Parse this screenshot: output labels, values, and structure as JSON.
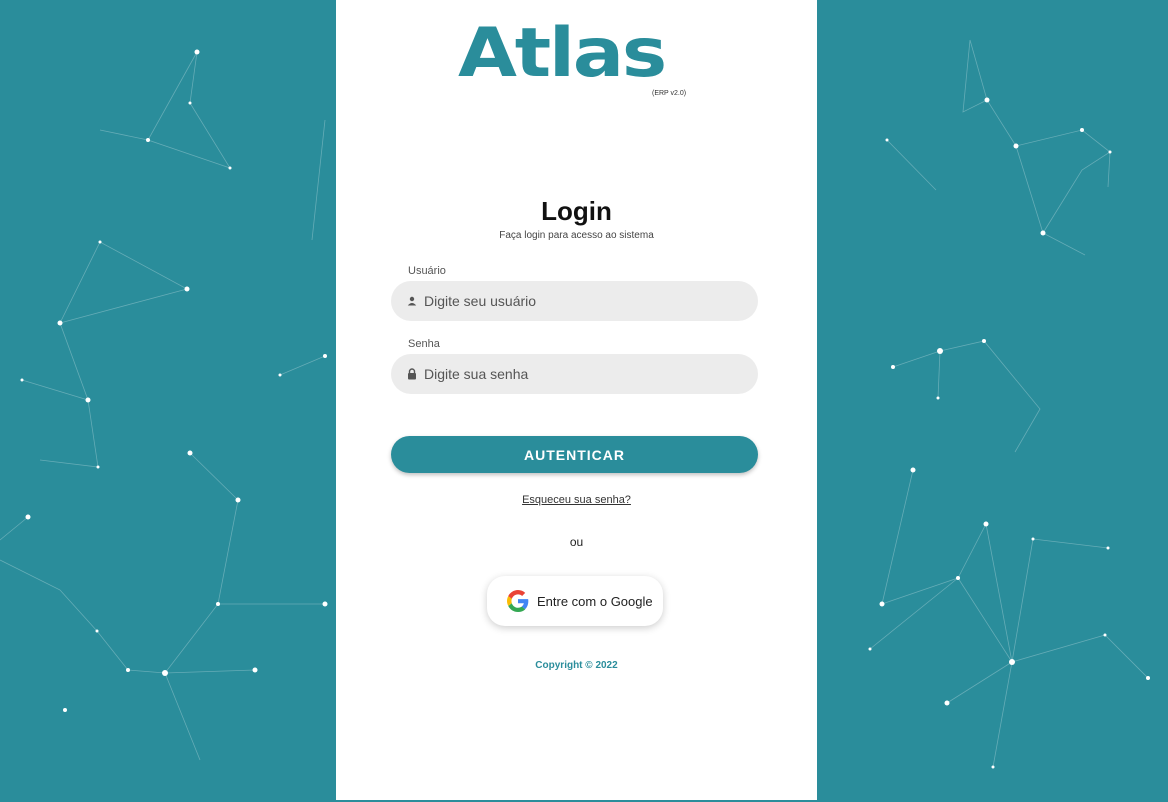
{
  "brand": {
    "logo_text": "Atlas",
    "version": "(ERP v2.0)",
    "color": "#2a8d9b"
  },
  "login": {
    "title": "Login",
    "subtitle": "Faça login para acesso ao sistema",
    "username_label": "Usuário",
    "username_placeholder": "Digite seu usuário",
    "password_label": "Senha",
    "password_placeholder": "Digite sua senha",
    "submit_label": "AUTENTICAR",
    "forgot_label": "Esqueceu sua senha?",
    "or_label": "ou",
    "google_label": "Entre com o Google"
  },
  "footer": {
    "copyright": "Copyright © 2022"
  },
  "icons": {
    "username": "user-icon",
    "password": "lock-icon",
    "google": "google-icon"
  }
}
